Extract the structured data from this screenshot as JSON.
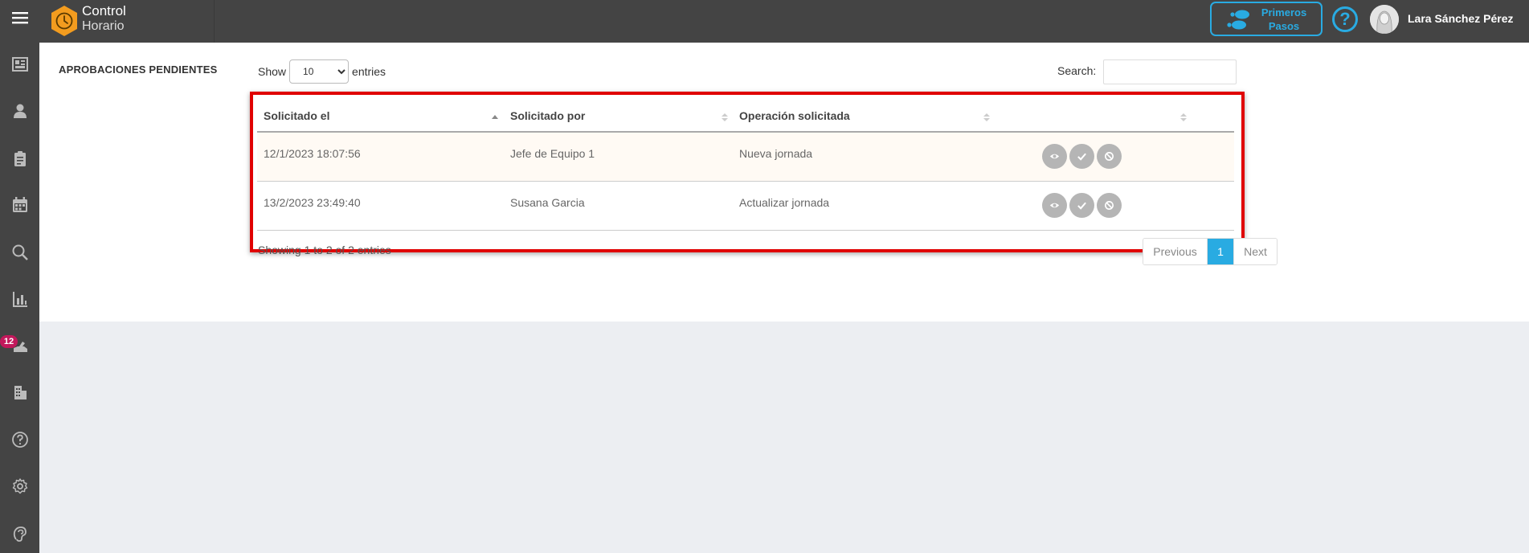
{
  "app": {
    "brand_line1": "Control",
    "brand_line2": "Horario",
    "first_steps_line1": "Primeros",
    "first_steps_line2": "Pasos",
    "help_symbol": "?",
    "user_name": "Lara Sánchez Pérez",
    "accent_color": "#29abe2",
    "logo_color": "#f39c1f"
  },
  "sidebar": {
    "items": [
      {
        "icon": "dashboard-icon"
      },
      {
        "icon": "user-icon"
      },
      {
        "icon": "clipboard-icon"
      },
      {
        "icon": "calendar-icon"
      },
      {
        "icon": "search-icon"
      },
      {
        "icon": "report-icon"
      },
      {
        "icon": "approvals-icon",
        "badge": "12"
      },
      {
        "icon": "building-icon"
      },
      {
        "icon": "help-icon"
      },
      {
        "icon": "settings-icon"
      },
      {
        "icon": "support-icon"
      }
    ]
  },
  "page": {
    "title": "APROBACIONES PENDIENTES",
    "show_label": "Show",
    "entries_label": "entries",
    "page_length": "10",
    "search_label": "Search:",
    "search_value": ""
  },
  "table": {
    "columns": [
      "Solicitado el",
      "Solicitado por",
      "Operación solicitada",
      ""
    ],
    "rows": [
      {
        "date": "12/1/2023 18:07:56",
        "by": "Jefe de Equipo 1",
        "operation": "Nueva jornada"
      },
      {
        "date": "13/2/2023 23:49:40",
        "by": "Susana Garcia",
        "operation": "Actualizar jornada"
      }
    ],
    "info": "Showing 1 to 2 of 2 entries",
    "pager": {
      "previous": "Previous",
      "current": "1",
      "next": "Next"
    }
  }
}
